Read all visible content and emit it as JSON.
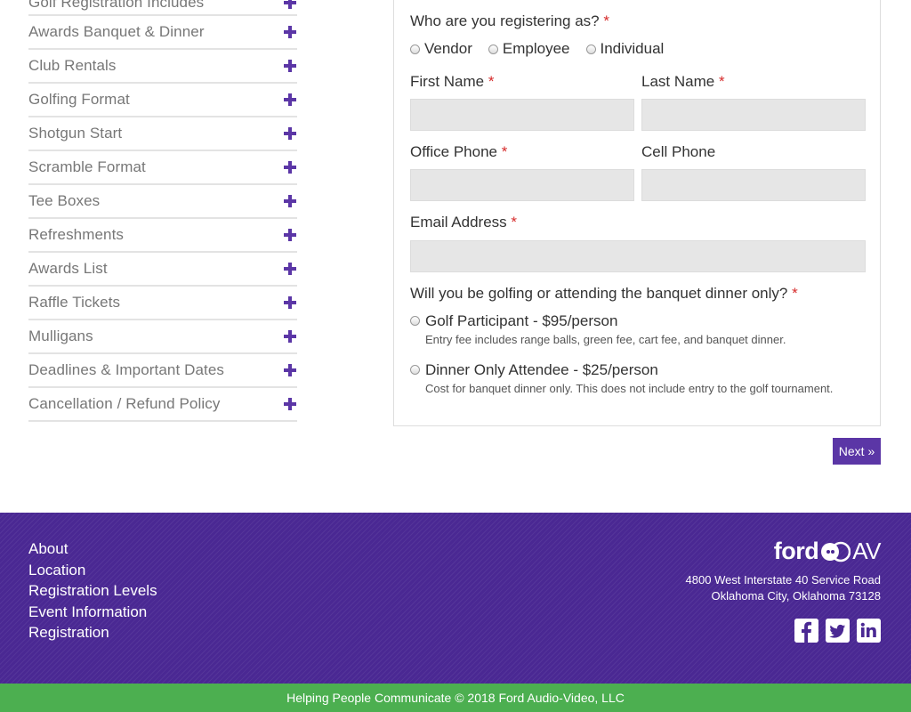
{
  "accordion": {
    "items": [
      {
        "label": "Golf Registration Includes"
      },
      {
        "label": "Awards Banquet & Dinner"
      },
      {
        "label": "Club Rentals"
      },
      {
        "label": "Golfing Format"
      },
      {
        "label": "Shotgun Start"
      },
      {
        "label": "Scramble Format"
      },
      {
        "label": "Tee Boxes"
      },
      {
        "label": "Refreshments"
      },
      {
        "label": "Awards List"
      },
      {
        "label": "Raffle Tickets"
      },
      {
        "label": "Mulligans"
      },
      {
        "label": "Deadlines & Important Dates"
      },
      {
        "label": "Cancellation / Refund Policy"
      }
    ]
  },
  "form": {
    "required_mark": "*",
    "registering_as": {
      "question": "Who are you registering as?",
      "options": [
        "Vendor",
        "Employee",
        "Individual"
      ]
    },
    "first_name_label": "First Name",
    "last_name_label": "Last Name",
    "office_phone_label": "Office Phone",
    "cell_phone_label": "Cell Phone",
    "email_label": "Email Address",
    "attendance": {
      "question": "Will you be golfing or attending the banquet dinner only?",
      "options": [
        {
          "title": "Golf Participant - $95/person",
          "desc": "Entry fee includes range balls, green fee, cart fee, and banquet dinner."
        },
        {
          "title": "Dinner Only Attendee - $25/person",
          "desc": "Cost for banquet dinner only. This does not include entry to the golf tournament."
        }
      ]
    },
    "next_label": "Next »"
  },
  "footer": {
    "links": [
      "About",
      "Location",
      "Registration Levels",
      "Event Information",
      "Registration"
    ],
    "logo_text": "ford",
    "logo_suffix": "AV",
    "address_line1": "4800 West Interstate 40 Service Road",
    "address_line2": "Oklahoma City, Oklahoma 73128",
    "social": [
      {
        "icon": "facebook-icon",
        "glyph": "f"
      },
      {
        "icon": "twitter-icon",
        "glyph": "t"
      },
      {
        "icon": "linkedin-icon",
        "glyph": "in"
      }
    ],
    "copyright": "Helping People Communicate © 2018 Ford Audio-Video, LLC"
  },
  "colors": {
    "accent": "#5b36a6",
    "footer_bg": "#4a2893",
    "bottom_bar": "#4caf50",
    "required": "#d62b2b"
  }
}
